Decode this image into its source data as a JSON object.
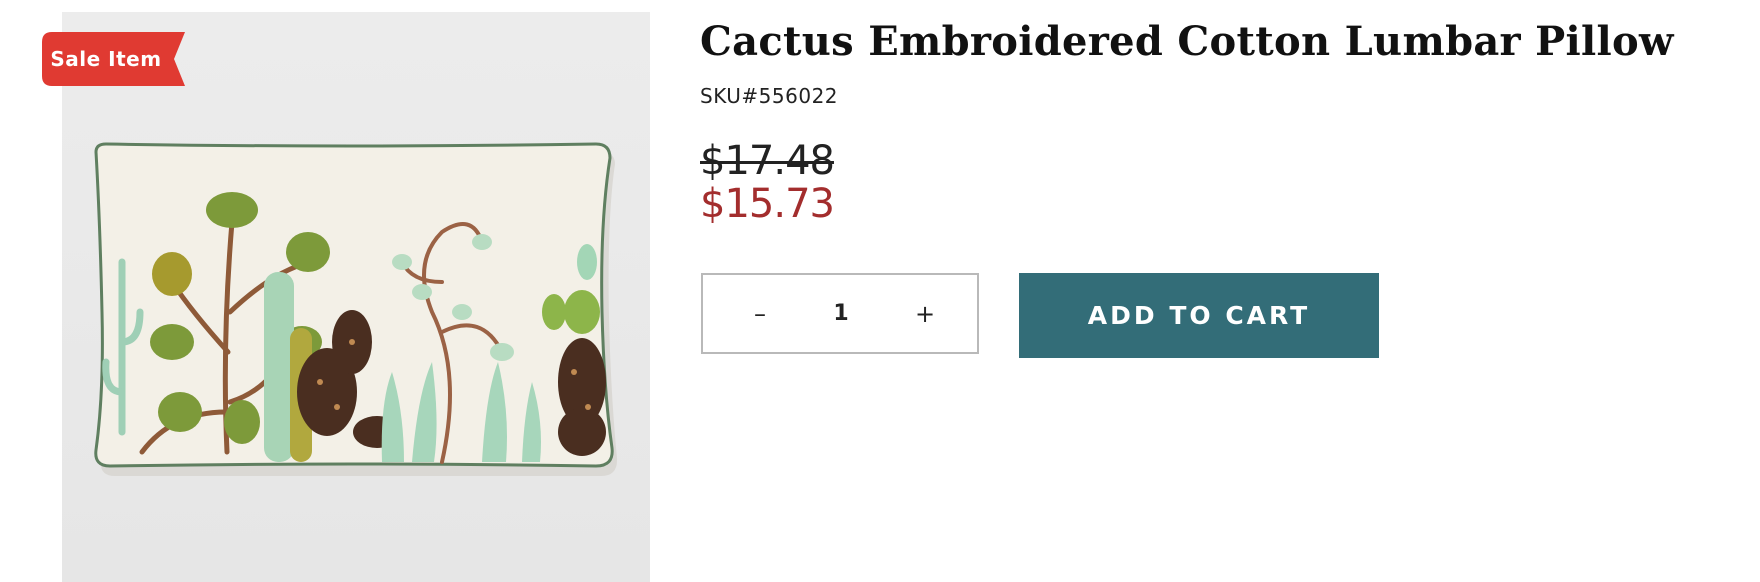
{
  "product": {
    "title": "Cactus Embroidered Cotton Lumbar Pillow",
    "sku": "SKU#556022",
    "original_price": "$17.48",
    "sale_price": "$15.73",
    "badge": "Sale Item",
    "image_alt": "cactus-embroidered-lumbar-pillow"
  },
  "quantity": {
    "decrement_label": "–",
    "increment_label": "+",
    "value": "1"
  },
  "actions": {
    "add_to_cart_label": "ADD TO CART"
  },
  "colors": {
    "badge": "#e03a32",
    "sale_price": "#a32d2d",
    "add_to_cart": "#336d78",
    "image_background": "#e8e8e8"
  }
}
